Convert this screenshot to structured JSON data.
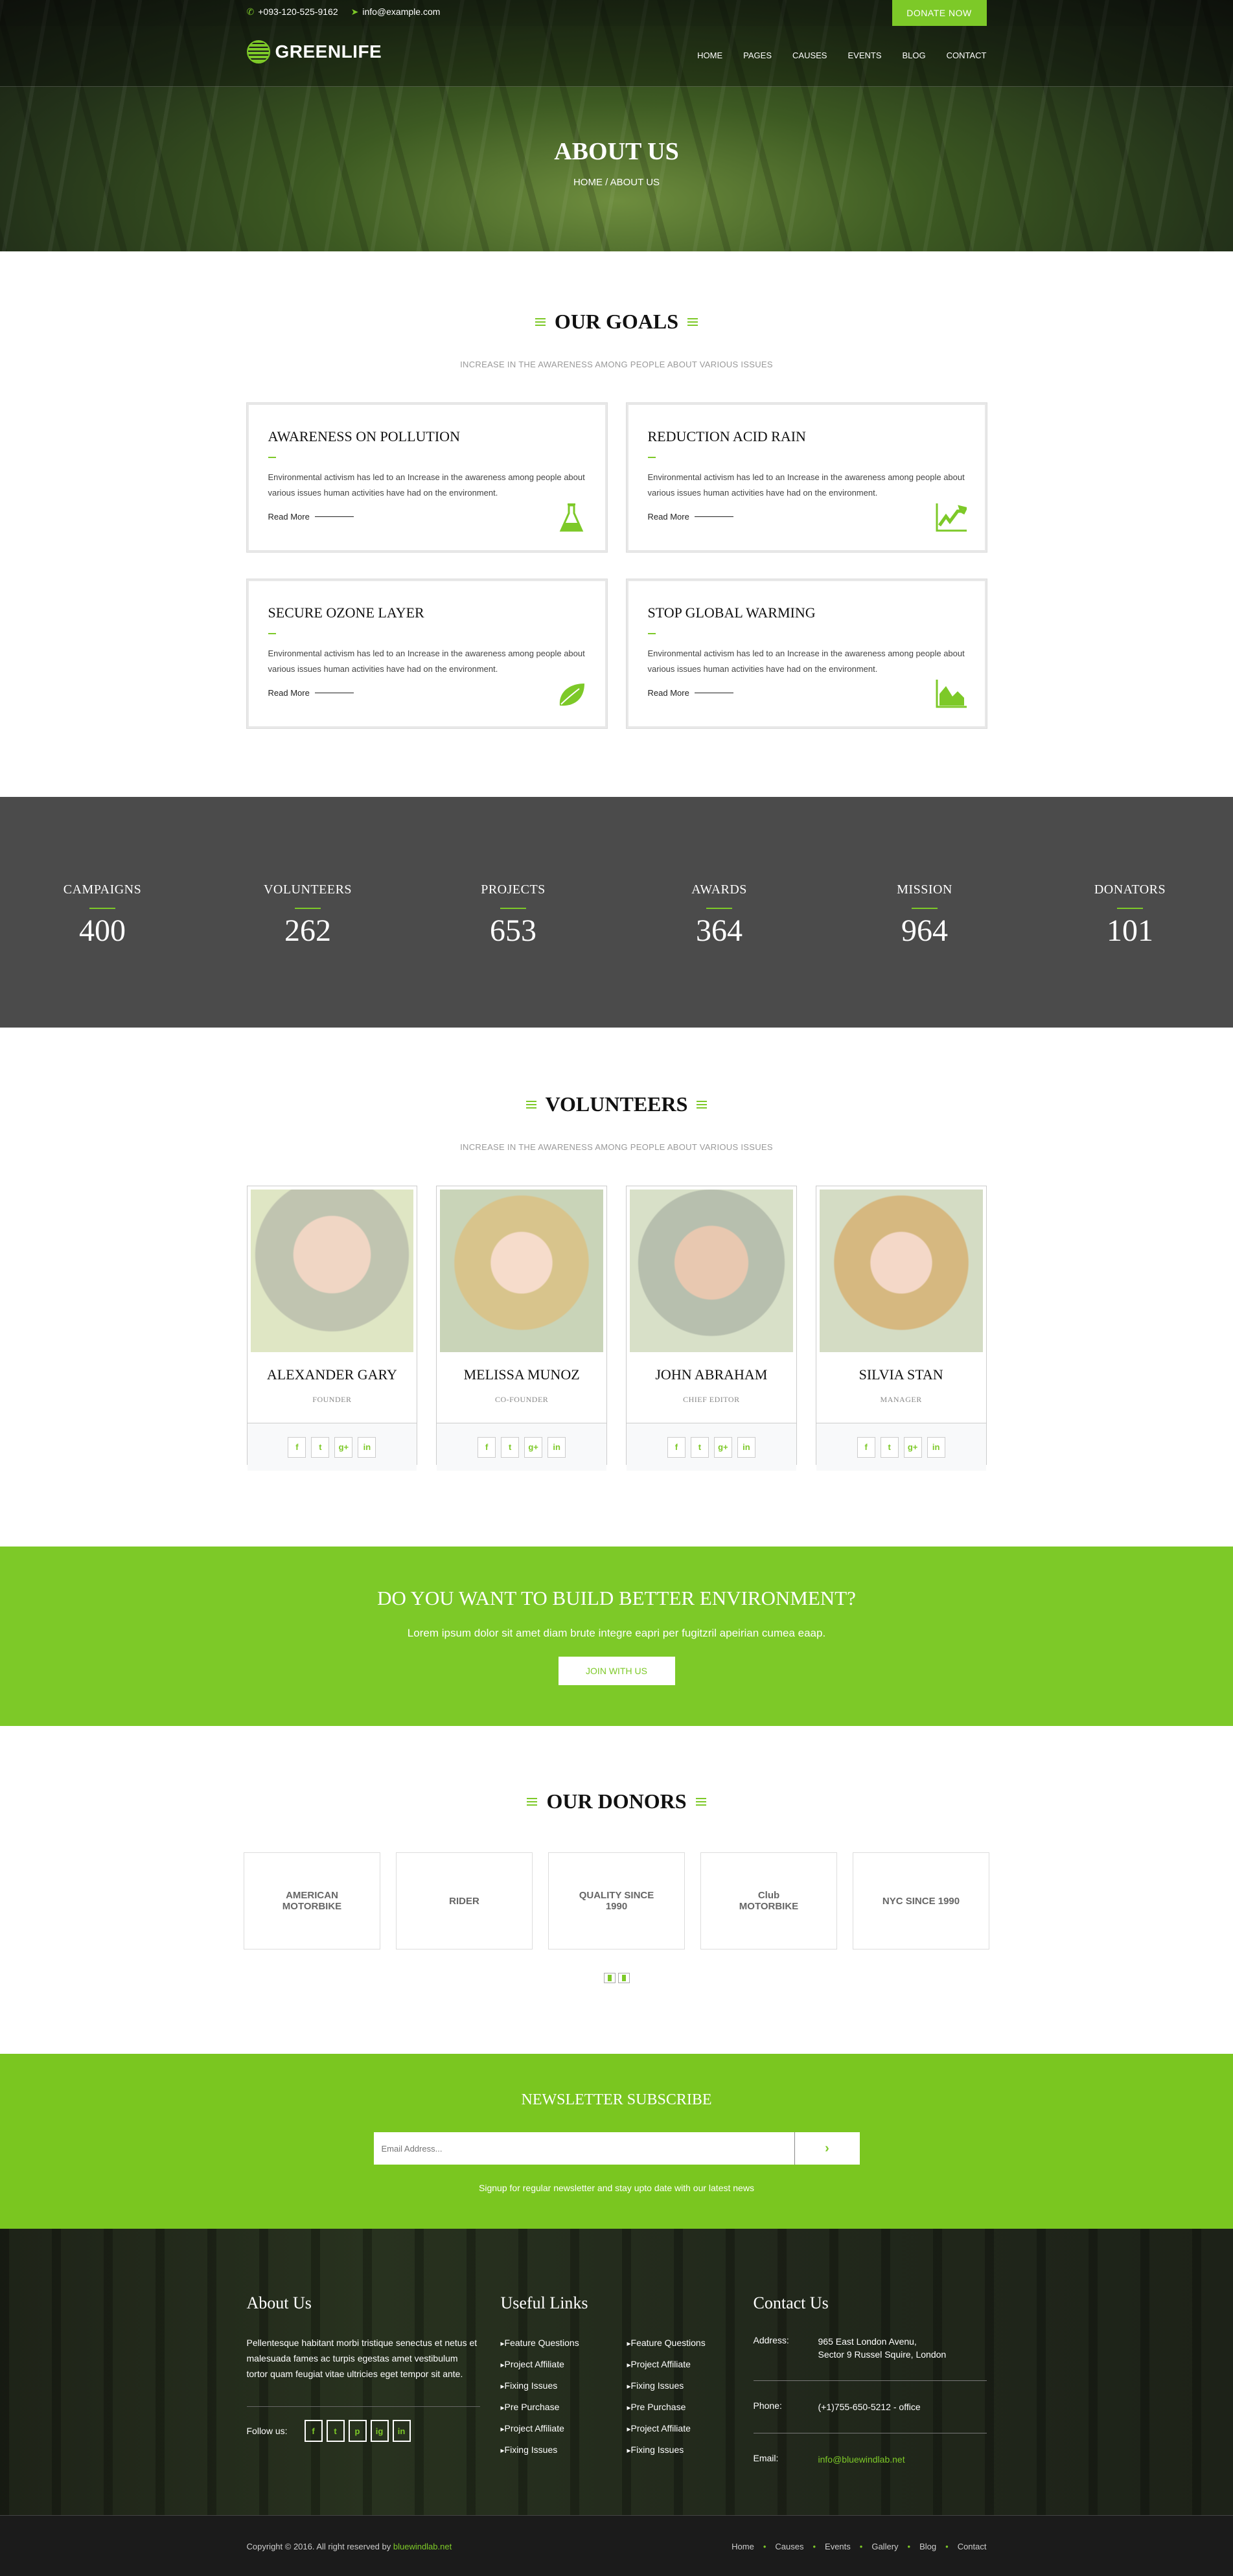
{
  "header": {
    "phone": "+093-120-525-9162",
    "email": "info@example.com",
    "donate_label": "DONATE NOW",
    "logo_text": "GREENLIFE",
    "nav": [
      "HOME",
      "PAGES",
      "CAUSES",
      "EVENTS",
      "BLOG",
      "CONTACT"
    ],
    "page_title": "ABOUT US",
    "breadcrumb": "HOME / ABOUT US"
  },
  "goals": {
    "title": "OUR GOALS",
    "subtitle": "INCREASE IN THE AWARENESS AMONG PEOPLE ABOUT VARIOUS ISSUES",
    "items": [
      {
        "title": "AWARENESS ON POLLUTION",
        "text": "Environmental activism has led to an Increase in the awareness among people about various issues human activities have had on the environment.",
        "link": "Read More",
        "icon": "flask-icon"
      },
      {
        "title": "REDUCTION ACID RAIN",
        "text": "Environmental activism has led to an Increase in the awareness among people about various issues human activities have had on the environment.",
        "link": "Read More",
        "icon": "line-chart-icon"
      },
      {
        "title": "SECURE OZONE LAYER",
        "text": "Environmental activism has led to an Increase in the awareness among people about various issues human activities have had on the environment.",
        "link": "Read More",
        "icon": "leaf-icon"
      },
      {
        "title": "STOP GLOBAL WARMING",
        "text": "Environmental activism has led to an Increase in the awareness among people about various issues human activities have had on the environment.",
        "link": "Read More",
        "icon": "area-chart-icon"
      }
    ]
  },
  "stats": [
    {
      "label": "CAMPAIGNS",
      "value": "400"
    },
    {
      "label": "VOLUNTEERS",
      "value": "262"
    },
    {
      "label": "PROJECTS",
      "value": "653"
    },
    {
      "label": "AWARDS",
      "value": "364"
    },
    {
      "label": "MISSION",
      "value": "964"
    },
    {
      "label": "DONATORS",
      "value": "101"
    }
  ],
  "volunteers": {
    "title": "VOLUNTEERS",
    "subtitle": "INCREASE IN THE AWARENESS AMONG PEOPLE ABOUT VARIOUS ISSUES",
    "people": [
      {
        "name": "ALEXANDER GARY",
        "role": "FOUNDER"
      },
      {
        "name": "MELISSA MUNOZ",
        "role": "CO-FOUNDER"
      },
      {
        "name": "JOHN ABRAHAM",
        "role": "CHIEF EDITOR"
      },
      {
        "name": "SILVIA STAN",
        "role": "MANAGER"
      }
    ],
    "social": [
      "f",
      "t",
      "g+",
      "in"
    ]
  },
  "cta": {
    "title": "DO YOU WANT TO BUILD BETTER ENVIRONMENT?",
    "text": "Lorem ipsum dolor sit amet diam brute integre eapri per fugitzril apeirian cumea eaap.",
    "button": "JOIN WITH US"
  },
  "donors": {
    "title": "OUR DONORS",
    "logos": [
      "AMERICAN MOTORBIKE",
      "RIDER",
      "QUALITY SINCE 1990",
      "Club MOTORBIKE",
      "NYC SINCE 1990"
    ]
  },
  "newsletter": {
    "title": "NEWSLETTER SUBSCRIBE",
    "placeholder": "Email Address...",
    "submit": "›",
    "caption": "Signup for regular newsletter and stay upto date with our latest news"
  },
  "footer": {
    "about_title": "About Us",
    "about_text": "Pellentesque habitant morbi tristique senectus et netus et malesuada fames ac turpis egestas amet vestibulum tortor quam feugiat vitae ultricies eget tempor sit ante.",
    "follow_label": "Follow us:",
    "follow_icons": [
      "f",
      "t",
      "p",
      "ig",
      "in"
    ],
    "links_title": "Useful Links",
    "links_col1": [
      "Feature Questions",
      "Project Affiliate",
      "Fixing Issues",
      "Pre Purchase",
      "Project Affiliate",
      "Fixing Issues"
    ],
    "links_col2": [
      "Feature Questions",
      "Project Affiliate",
      "Fixing Issues",
      "Pre Purchase",
      "Project Affiliate",
      "Fixing Issues"
    ],
    "contact_title": "Contact Us",
    "address_label": "Address:",
    "address_line1": "965 East London Avenu,",
    "address_line2": "Sector 9 Russel Squire, London",
    "phone_label": "Phone:",
    "phone": "(+1)755-650-5212 - office",
    "email_label": "Email:",
    "email": "info@bluewindlab.net",
    "copyright": "Copyright © 2016. All right reserved by ",
    "copyright_link": "bluewindlab.net",
    "bottom_links": [
      "Home",
      "Causes",
      "Events",
      "Gallery",
      "Blog",
      "Contact"
    ]
  },
  "colors": {
    "accent": "#7dc928",
    "stats_bg": "#4b4b4b",
    "footer_bottom": "#1b1b1b"
  }
}
